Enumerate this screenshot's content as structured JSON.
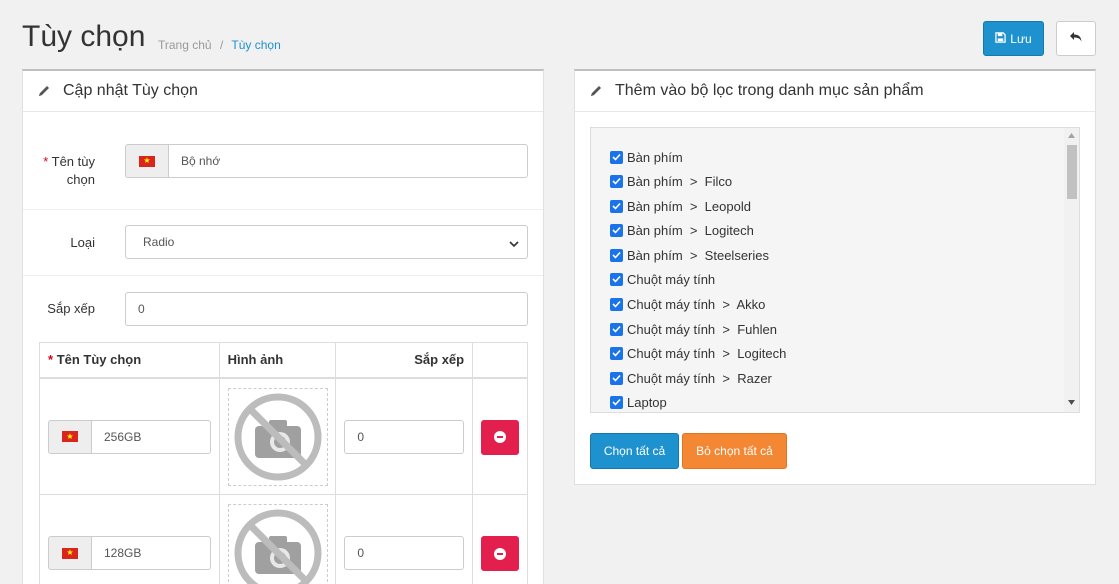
{
  "header": {
    "title": "Tùy chọn",
    "breadcrumb": [
      {
        "label": "Trang chủ"
      },
      {
        "label": "Tùy chọn"
      }
    ],
    "breadcrumb_sep": "/",
    "save_label": "Lưu",
    "save_icon": "floppy-disk-icon",
    "back_icon": "reply-arrow-icon"
  },
  "left_panel": {
    "heading": "Cập nhật Tùy chọn",
    "name_field": {
      "label_line1": "Tên tùy",
      "label_line2": "chọn",
      "required_mark": "*",
      "value": "Bộ nhớ",
      "flag": "vietnam-flag-icon"
    },
    "type_field": {
      "label": "Loại",
      "value": "Radio"
    },
    "sort_field": {
      "label": "Sắp xếp",
      "value": "0"
    },
    "table": {
      "headers": [
        "Tên Tùy chọn",
        "Hình ảnh",
        "Sắp xếp",
        ""
      ],
      "header_required_mark": "*",
      "rows": [
        {
          "name": "256GB",
          "sort": "0",
          "image_icon": "no-camera-icon"
        },
        {
          "name": "128GB",
          "sort": "0",
          "image_icon": "no-camera-icon"
        }
      ]
    }
  },
  "right_panel": {
    "heading": "Thêm vào bộ lọc trong danh mục sản phẩm",
    "categories": [
      {
        "label": "Bàn phím",
        "checked": true
      },
      {
        "label": "Bàn phím  >  Filco",
        "checked": true
      },
      {
        "label": "Bàn phím  >  Leopold",
        "checked": true
      },
      {
        "label": "Bàn phím  >  Logitech",
        "checked": true
      },
      {
        "label": "Bàn phím  >  Steelseries",
        "checked": true
      },
      {
        "label": "Chuột máy tính",
        "checked": true
      },
      {
        "label": "Chuột máy tính  >  Akko",
        "checked": true
      },
      {
        "label": "Chuột máy tính  >  Fuhlen",
        "checked": true
      },
      {
        "label": "Chuột máy tính  >  Logitech",
        "checked": true
      },
      {
        "label": "Chuột máy tính  >  Razer",
        "checked": true
      },
      {
        "label": "Laptop",
        "checked": true
      }
    ],
    "select_all_label": "Chọn tất cả",
    "deselect_all_label": "Bỏ chọn tất cả"
  },
  "colors": {
    "primary": "#1e91cf",
    "danger": "#e3204d",
    "warning": "#f38733",
    "checkbox": "#1a73e8"
  }
}
